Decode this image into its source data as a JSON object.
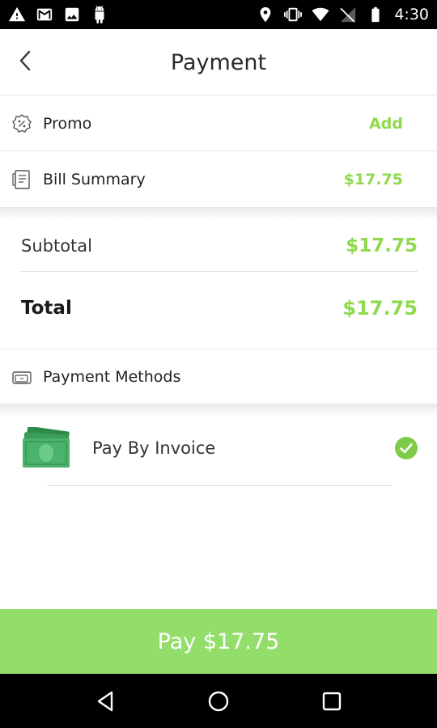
{
  "status_bar": {
    "time": "4:30",
    "left_icons": [
      "warning-icon",
      "gmail-icon",
      "image-icon",
      "android-icon"
    ],
    "right_icons": [
      "location-icon",
      "vibrate-icon",
      "wifi-icon",
      "no-signal-icon",
      "battery-icon"
    ]
  },
  "header": {
    "title": "Payment",
    "back_icon": "chevron-left-icon"
  },
  "promo": {
    "label": "Promo",
    "action": "Add",
    "icon": "discount-badge-icon"
  },
  "bill_summary": {
    "label": "Bill Summary",
    "amount": "$17.75",
    "icon": "receipt-icon"
  },
  "summary": {
    "subtotal_label": "Subtotal",
    "subtotal_value": "$17.75",
    "total_label": "Total",
    "total_value": "$17.75"
  },
  "payment_methods": {
    "label": "Payment Methods",
    "icon": "wallet-icon",
    "items": [
      {
        "label": "Pay By Invoice",
        "selected": true,
        "icon": "cash-icon"
      }
    ]
  },
  "pay_button": {
    "label": "Pay $17.75"
  },
  "nav": {
    "back": "nav-back-icon",
    "home": "nav-home-icon",
    "recents": "nav-recents-icon"
  },
  "colors": {
    "accent": "#8fd94e",
    "pay_button": "#93dd6a",
    "status_bar": "#000000"
  }
}
